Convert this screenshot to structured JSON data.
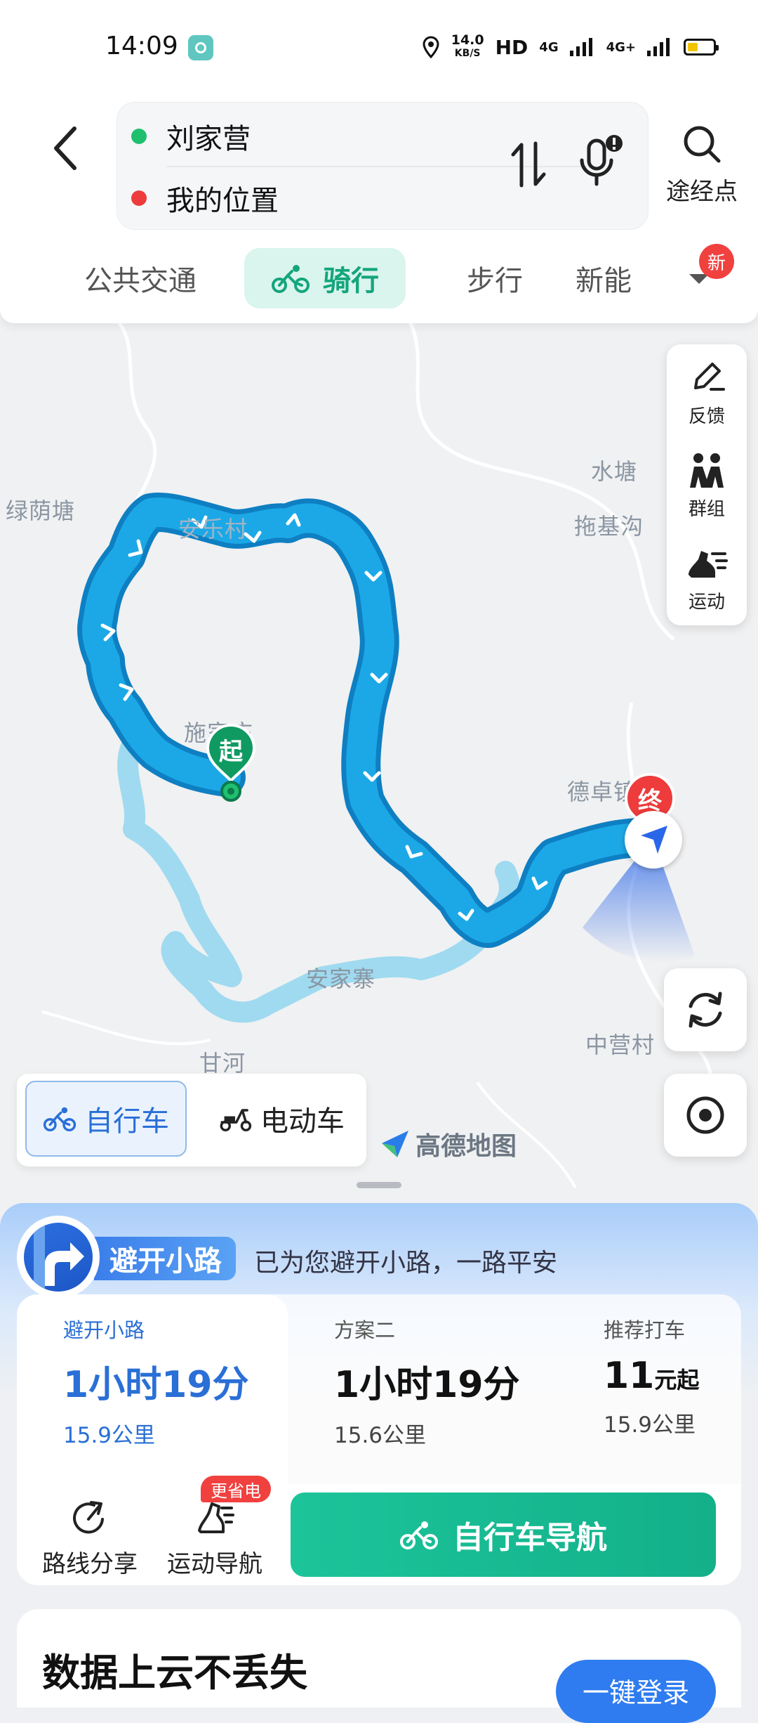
{
  "status_bar": {
    "time": "14:09",
    "net_speed_value": "14.0",
    "net_speed_unit": "KB/S",
    "hd_label": "HD",
    "sim1_label": "4G",
    "sim2_label": "4G+",
    "icons": [
      "location-icon",
      "signal-icon",
      "battery-icon"
    ]
  },
  "header": {
    "origin": "刘家营",
    "destination": "我的位置",
    "origin_color": "#1fbf6e",
    "destination_color": "#ee3b3b",
    "waypoint_label": "途经点",
    "tabs": [
      {
        "label": "公共交通",
        "active": false
      },
      {
        "label": "骑行",
        "active": true
      },
      {
        "label": "步行",
        "active": false
      },
      {
        "label": "新能",
        "active": false
      }
    ],
    "new_badge": "新"
  },
  "map": {
    "places": [
      "绿荫塘",
      "安乐村",
      "水塘",
      "拖基沟",
      "施家庄",
      "德卓镇",
      "安家寨",
      "甘河",
      "中营村"
    ],
    "start_marker": "起",
    "end_marker": "终",
    "route_color": "#1ca8e6",
    "alt_route_color": "#a9dff1",
    "tools": [
      {
        "label": "反馈",
        "icon": "pen-icon"
      },
      {
        "label": "群组",
        "icon": "group-icon"
      },
      {
        "label": "运动",
        "icon": "sport-shoe-icon"
      }
    ],
    "vehicle_options": [
      {
        "label": "自行车",
        "active": true
      },
      {
        "label": "电动车",
        "active": false
      }
    ],
    "logo_text": "高德地图"
  },
  "sheet": {
    "avoid_title": "避开小路",
    "avoid_message": "已为您避开小路，一路平安",
    "plans": [
      {
        "name": "避开小路",
        "time": "1小时19分",
        "distance": "15.9公里",
        "active": true
      },
      {
        "name": "方案二",
        "time": "1小时19分",
        "distance": "15.6公里",
        "active": false
      },
      {
        "name": "推荐打车",
        "price": "11",
        "price_unit": "元起",
        "distance": "15.9公里",
        "active": false
      }
    ],
    "actions": [
      {
        "label": "路线分享",
        "icon": "share-icon"
      },
      {
        "label": "运动导航",
        "icon": "sport-nav-icon",
        "badge": "更省电"
      }
    ],
    "nav_button": "自行车导航",
    "accent_color": "#16b98f",
    "cloud_title": "数据上云不丢失",
    "login_button": "一键登录"
  }
}
